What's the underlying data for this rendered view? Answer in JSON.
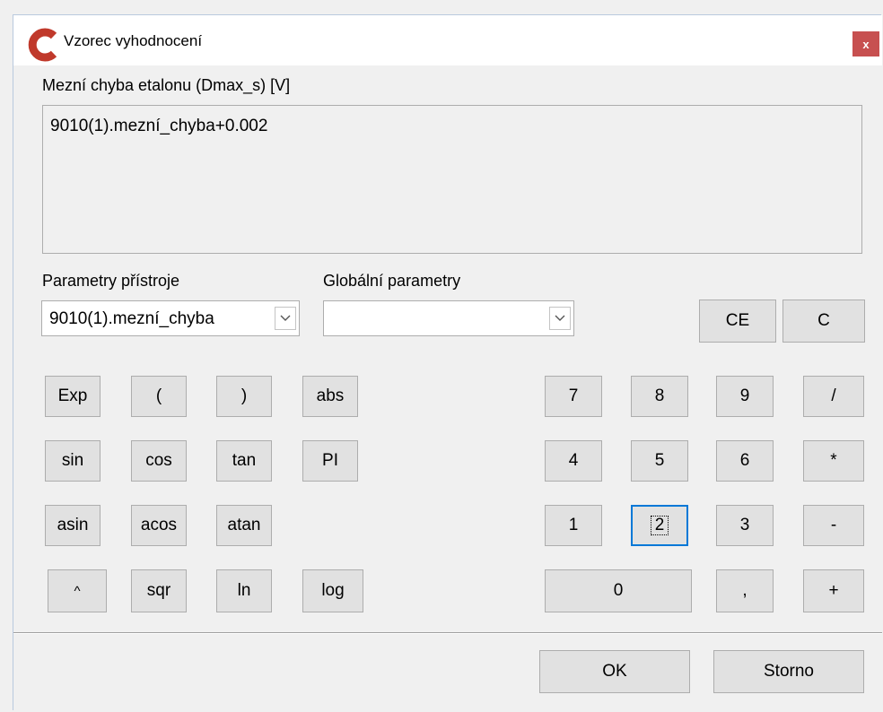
{
  "window": {
    "title": "Vzorec vyhodnocení",
    "close_label": "x",
    "accent_color": "#c0392b",
    "close_color": "#c75050"
  },
  "formula": {
    "label": "Mezní chyba etalonu (Dmax_s) [V]",
    "value": "9010(1).mezní_chyba+0.002"
  },
  "device_params": {
    "label": "Parametry přístroje",
    "selected": "9010(1).mezní_chyba"
  },
  "global_params": {
    "label": "Globální parametry",
    "selected": ""
  },
  "function_buttons": {
    "exp": "Exp",
    "lparen": "(",
    "rparen": ")",
    "abs": "abs",
    "sin": "sin",
    "cos": "cos",
    "tan": "tan",
    "pi": "PI",
    "asin": "asin",
    "acos": "acos",
    "atan": "atan",
    "pow": "^",
    "sqr": "sqr",
    "ln": "ln",
    "log": "log"
  },
  "keypad": {
    "ce": "CE",
    "c": "C",
    "d7": "7",
    "d8": "8",
    "d9": "9",
    "div": "/",
    "d4": "4",
    "d5": "5",
    "d6": "6",
    "mul": "*",
    "d1": "1",
    "d2": "2",
    "d3": "3",
    "minus": "-",
    "d0": "0",
    "comma": ",",
    "plus": "+"
  },
  "footer": {
    "ok": "OK",
    "cancel": "Storno"
  }
}
